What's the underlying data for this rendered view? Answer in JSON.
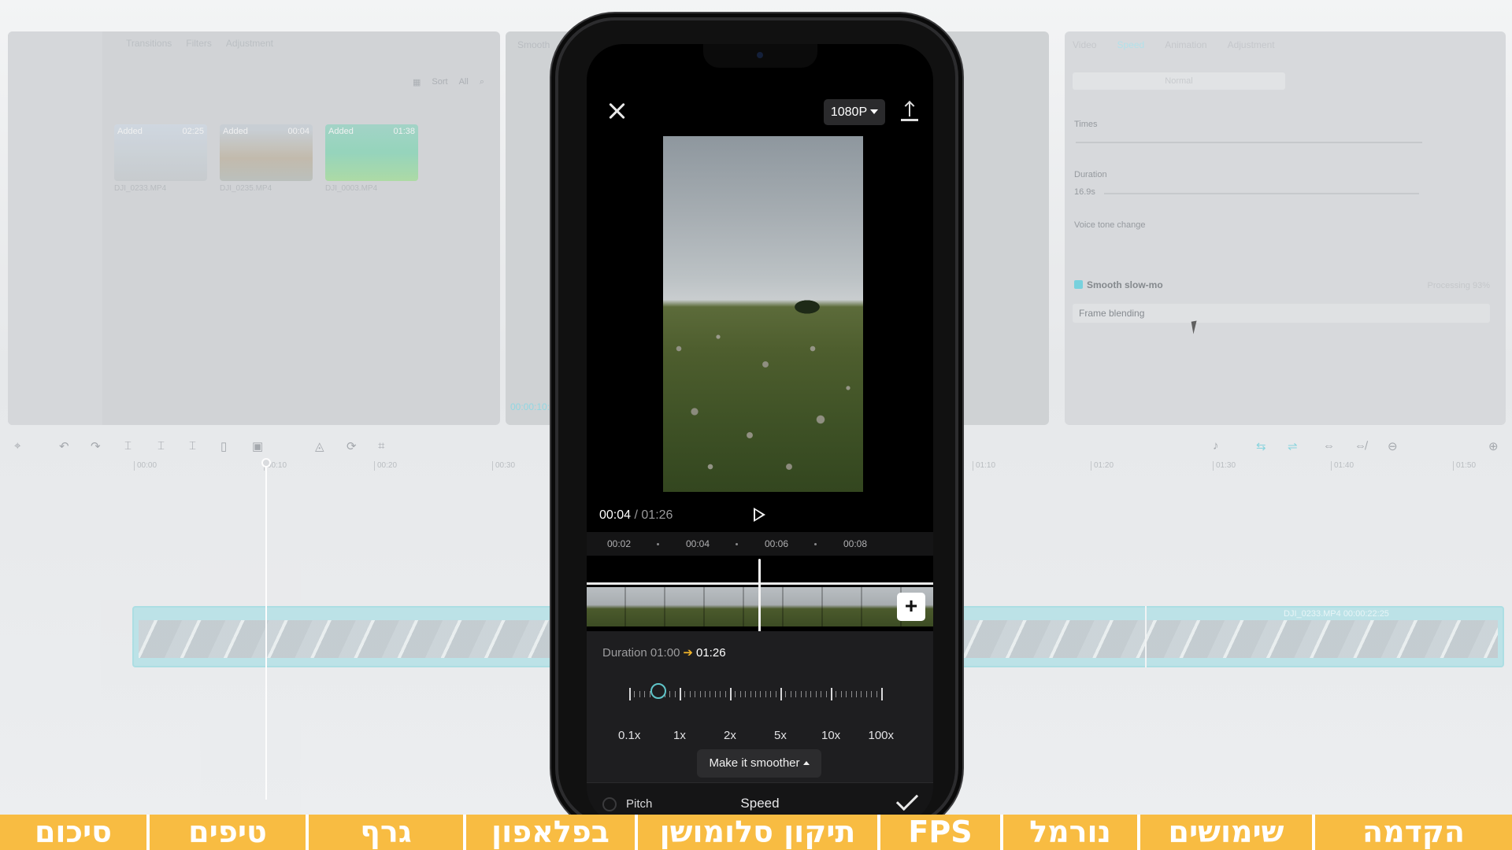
{
  "background_editor": {
    "media_tabs": [
      "Transitions",
      "Filters",
      "Adjustment"
    ],
    "media_tools": [
      "Sort",
      "All"
    ],
    "thumbnails": [
      {
        "tag": "Added",
        "duration": "02:25",
        "name": "DJI_0233.MP4"
      },
      {
        "tag": "Added",
        "duration": "00:04",
        "name": "DJI_0235.MP4"
      },
      {
        "tag": "Added",
        "duration": "01:38",
        "name": "DJI_0003.MP4"
      }
    ],
    "player_title": "Smooth",
    "player_time": "00:00:10:2",
    "props_tabs": [
      "Video",
      "Speed",
      "Animation",
      "Adjustment"
    ],
    "props_normal": "Normal",
    "times_label": "Times",
    "duration_label": "Duration",
    "duration_value": "16.9s",
    "voice_tone_label": "Voice tone change",
    "smooth_slowmo_label": "Smooth slow-mo",
    "processing_label": "Processing 93%",
    "frame_blending_label": "Frame blending",
    "ruler_ticks": [
      "00:00",
      "00:10",
      "00:20",
      "00:30",
      "01:10",
      "01:20",
      "01:30",
      "01:40",
      "01:50"
    ],
    "track_label": "DJI_0233.MP4  00:00:22:25"
  },
  "phone": {
    "resolution": "1080P",
    "current_time": "00:04",
    "total_time": "01:26",
    "time_separator": " / ",
    "ruler_labels": [
      "00:02",
      "00:04",
      "00:06",
      "00:08"
    ],
    "duration_label": "Duration",
    "duration_old": "01:00",
    "duration_new": "01:26",
    "speed_labels": [
      "0.1x",
      "1x",
      "2x",
      "5x",
      "10x",
      "100x"
    ],
    "speed_value_fraction": 0.12,
    "smoother_label": "Make it smoother",
    "pitch_label": "Pitch",
    "panel_title": "Speed"
  },
  "chapters": [
    {
      "label": "הקדמה"
    },
    {
      "label": "שימושים"
    },
    {
      "label": "נורמל"
    },
    {
      "label": "FPS"
    },
    {
      "label": "תיקון סלומושן"
    },
    {
      "label": "בפלאפון"
    },
    {
      "label": "גרף"
    },
    {
      "label": "טיפים"
    },
    {
      "label": "סיכום"
    }
  ],
  "colors": {
    "accent": "#5fc5c9",
    "chapter_bg": "#f8bc42",
    "chapter_active_bg": "#fbd98f",
    "duration_arrow": "#f0b429"
  }
}
